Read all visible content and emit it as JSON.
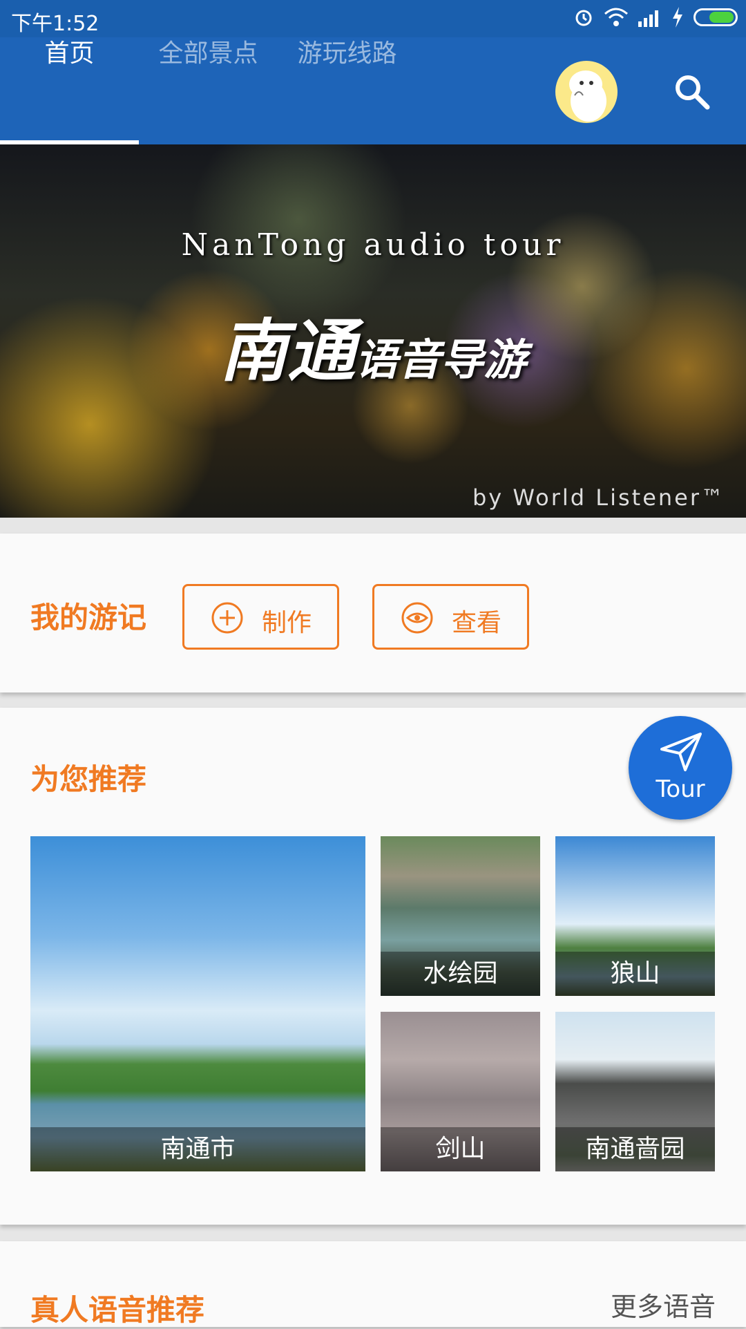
{
  "status_bar": {
    "time": "下午1:52"
  },
  "tabs": [
    {
      "label": "首页",
      "active": true
    },
    {
      "label": "全部景点",
      "active": false
    },
    {
      "label": "游玩线路",
      "active": false
    }
  ],
  "banner": {
    "title_en": "NanTong audio tour",
    "title_cn_big": "南通",
    "title_cn_small": "语音导游",
    "byline": "by World Listener™"
  },
  "travelogue": {
    "title": "我的游记",
    "make_label": "制作",
    "view_label": "查看"
  },
  "recommend": {
    "title": "为您推荐",
    "tour_label": "Tour",
    "spots": [
      {
        "name": "南通市"
      },
      {
        "name": "水绘园"
      },
      {
        "name": "狼山"
      },
      {
        "name": "剑山"
      },
      {
        "name": "南通啬园"
      }
    ]
  },
  "voice": {
    "title": "真人语音推荐",
    "more_label": "更多语音"
  },
  "colors": {
    "primary": "#1e64b8",
    "accent": "#f07a22",
    "tour": "#1e6ed8"
  }
}
